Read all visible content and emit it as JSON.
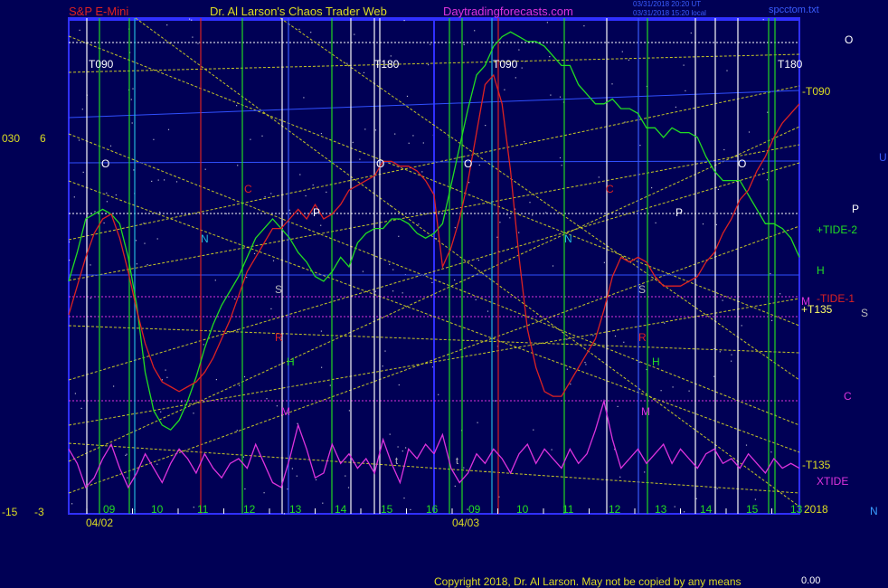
{
  "header": {
    "title_left": "S&P E-Mini",
    "title_center": "Dr. Al Larson's Chaos Trader Web",
    "title_site": "Daytradingforecasts.com",
    "stamp1": "03/31/2018 20:20 UT",
    "stamp2": "03/31/2018 15:20 local",
    "file": "spcctom.txt"
  },
  "footer": {
    "copyright": "Copyright 2018, Dr. Al Larson. May not be copied by any means",
    "code": "0.00"
  },
  "colors": {
    "background": "#000055",
    "frame": "#3030ff",
    "green_line": "#22dd22",
    "red_line": "#dd2222",
    "xtide": "#dd33dd",
    "yellow": "#dddd22"
  },
  "chart_data": {
    "type": "line",
    "x_unit": "hour",
    "days": [
      {
        "date": "04/02",
        "hours": [
          "09",
          "10",
          "11",
          "12",
          "13",
          "14",
          "15",
          "16"
        ]
      },
      {
        "date": "04/03",
        "hours": [
          "09",
          "10",
          "11",
          "12",
          "13",
          "14",
          "15",
          "13"
        ]
      }
    ],
    "year_label": "2018",
    "left_axis": {
      "top_labels": [
        "030",
        "6"
      ],
      "bottom_labels": [
        "-15",
        "-3"
      ]
    },
    "right_labels": {
      "lines": [
        "-T090",
        "+TIDE-2",
        "H",
        "M",
        "-TIDE-1",
        "+T135",
        "-T135",
        "XTIDE"
      ],
      "planets": [
        "O",
        "U",
        "P",
        "S",
        "C",
        "N"
      ]
    },
    "top_markers": [
      "T090",
      "T180",
      "T090",
      "T180"
    ],
    "chart_letters": [
      "O",
      "C",
      "N",
      "P",
      "S",
      "R",
      "H",
      "M",
      "t"
    ],
    "series": [
      {
        "name": "+TIDE-2",
        "color": "#22dd22",
        "values": [
          47,
          53,
          60,
          61,
          62,
          61,
          59,
          52,
          42,
          28,
          20,
          17,
          16,
          18,
          22,
          27,
          33,
          38,
          42,
          45,
          48,
          52,
          56,
          58,
          60,
          58,
          56,
          53,
          51,
          48,
          47,
          49,
          52,
          50,
          55,
          57,
          58,
          58,
          60,
          60,
          59,
          57,
          56,
          57,
          59,
          67,
          75,
          83,
          90,
          92,
          96,
          98,
          99,
          98,
          97,
          97,
          96,
          94,
          92,
          92,
          88,
          86,
          84,
          84,
          85,
          83,
          83,
          82,
          79,
          79,
          77,
          79,
          78,
          78,
          77,
          73,
          70,
          68,
          68,
          68,
          65,
          62,
          59,
          59,
          58,
          56,
          52
        ]
      },
      {
        "name": "-TIDE-1",
        "color": "#dd2222",
        "values": [
          40,
          46,
          52,
          57,
          60,
          61,
          56,
          49,
          41,
          34,
          29,
          26,
          25,
          24,
          25,
          26,
          28,
          31,
          35,
          39,
          44,
          49,
          52,
          55,
          58,
          58,
          60,
          62,
          60,
          63,
          60,
          61,
          63,
          66,
          67,
          68,
          69,
          72,
          72,
          71,
          71,
          70,
          68,
          65,
          50,
          54,
          60,
          68,
          78,
          88,
          90,
          84,
          70,
          52,
          37,
          29,
          24,
          23,
          23,
          26,
          29,
          32,
          35,
          41,
          48,
          52,
          51,
          52,
          51,
          48,
          46,
          46,
          46,
          47,
          48,
          51,
          53,
          57,
          60,
          64,
          66,
          70,
          73,
          77,
          80,
          82,
          84
        ]
      },
      {
        "name": "XTIDE",
        "color": "#dd33dd",
        "values": [
          12,
          9,
          4,
          6,
          10,
          13,
          8,
          4,
          7,
          11,
          8,
          5,
          9,
          12,
          10,
          7,
          11,
          8,
          6,
          9,
          10,
          8,
          13,
          9,
          5,
          4,
          10,
          17,
          12,
          6,
          7,
          13,
          9,
          11,
          8,
          10,
          7,
          14,
          9,
          5,
          12,
          10,
          13,
          11,
          15,
          8,
          5,
          7,
          11,
          9,
          12,
          10,
          7,
          11,
          13,
          9,
          12,
          10,
          8,
          12,
          9,
          11,
          16,
          22,
          14,
          8,
          10,
          12,
          9,
          11,
          13,
          9,
          12,
          10,
          8,
          11,
          12,
          9,
          10,
          8,
          11,
          9,
          7,
          10,
          8,
          9,
          8
        ]
      }
    ]
  }
}
